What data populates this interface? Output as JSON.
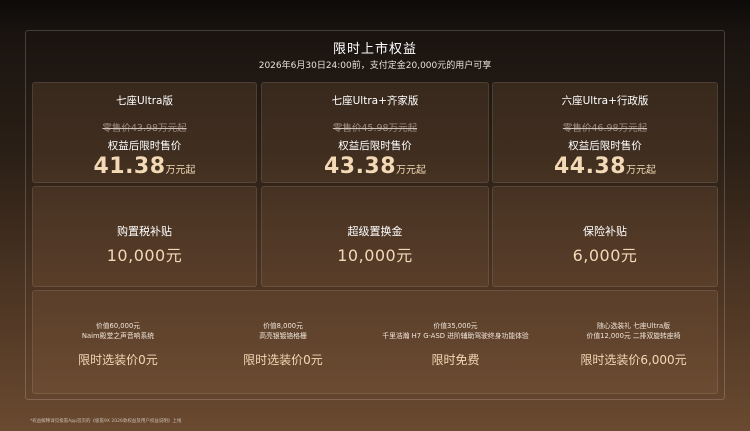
{
  "header": {
    "title": "限时上市权益",
    "subtitle": "2026年6月30日24:00前，支付定金20,000元的用户可享"
  },
  "models": [
    {
      "name": "七座Ultra版",
      "retail": "零售价43.98万元起",
      "after_label": "权益后限时售价",
      "price": "41.38",
      "unit": "万元起"
    },
    {
      "name": "七座Ultra+齐家版",
      "retail": "零售价45.98万元起",
      "after_label": "权益后限时售价",
      "price": "43.38",
      "unit": "万元起"
    },
    {
      "name": "六座Ultra+行政版",
      "retail": "零售价46.98万元起",
      "after_label": "权益后限时售价",
      "price": "44.38",
      "unit": "万元起"
    }
  ],
  "subsidies": [
    {
      "label": "购置税补贴",
      "amount": "10,000元"
    },
    {
      "label": "超级置换金",
      "amount": "10,000元"
    },
    {
      "label": "保险补贴",
      "amount": "6,000元"
    }
  ],
  "options": [
    {
      "line1": "价值60,000元",
      "line2": "Naim殿堂之声音响系统",
      "offer": "限时选装价0元"
    },
    {
      "line1": "价值8,000元",
      "line2": "高亮银镀铬格栅",
      "offer": "限时选装价0元"
    },
    {
      "line1": "价值35,000元",
      "line2": "千里浩瀚 H7 G-ASD 进阶辅助驾驶终身功能体验",
      "offer": "限时免费"
    },
    {
      "line1": "随心选装礼 七座Ultra版",
      "line2": "价值12,000元 二排双旋转座椅",
      "offer": "限时选装价6,000元"
    }
  ],
  "footnote": "*权益解释详见极氪App首页的《极氪9X 2026款权益及用户权益说明》上线"
}
